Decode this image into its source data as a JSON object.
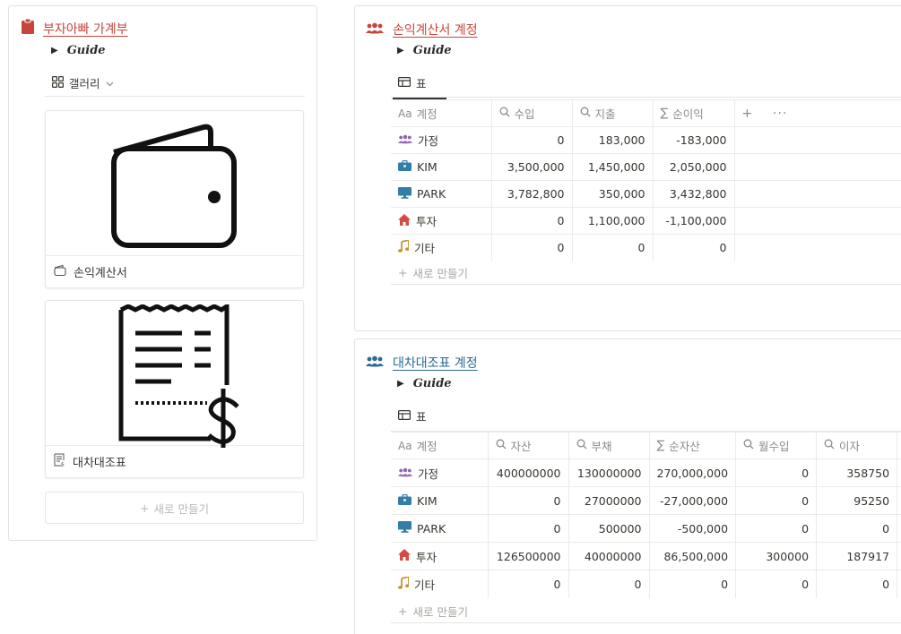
{
  "left": {
    "title": "부자아빠 가계부",
    "guide": "Guide",
    "view": "갤러리",
    "cards": [
      "손익계산서",
      "대차대조표"
    ],
    "new_label": "새로 만들기"
  },
  "pl": {
    "title": "손익계산서 계정",
    "guide": "Guide",
    "tab": "표",
    "columns": [
      "계정",
      "수입",
      "지출",
      "순이익"
    ],
    "rows": [
      {
        "name": "가정",
        "c1": "0",
        "c2": "183,000",
        "c3": "-183,000"
      },
      {
        "name": "KIM",
        "c1": "3,500,000",
        "c2": "1,450,000",
        "c3": "2,050,000"
      },
      {
        "name": "PARK",
        "c1": "3,782,800",
        "c2": "350,000",
        "c3": "3,432,800"
      },
      {
        "name": "투자",
        "c1": "0",
        "c2": "1,100,000",
        "c3": "-1,100,000"
      },
      {
        "name": "기타",
        "c1": "0",
        "c2": "0",
        "c3": "0"
      }
    ],
    "new_label": "새로 만들기",
    "add_col": "+",
    "more": "···"
  },
  "bs": {
    "title": "대차대조표 계정",
    "guide": "Guide",
    "tab": "표",
    "columns": [
      "계정",
      "자산",
      "부채",
      "순자산",
      "월수입",
      "이자"
    ],
    "rows": [
      {
        "name": "가정",
        "c1": "400000000",
        "c2": "130000000",
        "c3": "270,000,000",
        "c4": "0",
        "c5": "358750"
      },
      {
        "name": "KIM",
        "c1": "0",
        "c2": "27000000",
        "c3": "-27,000,000",
        "c4": "0",
        "c5": "95250"
      },
      {
        "name": "PARK",
        "c1": "0",
        "c2": "500000",
        "c3": "-500,000",
        "c4": "0",
        "c5": "0"
      },
      {
        "name": "투자",
        "c1": "126500000",
        "c2": "40000000",
        "c3": "86,500,000",
        "c4": "300000",
        "c5": "187917"
      },
      {
        "name": "기타",
        "c1": "0",
        "c2": "0",
        "c3": "0",
        "c4": "0",
        "c5": "0"
      }
    ],
    "new_label": "새로 만들기"
  },
  "icons": {
    "left_title": "clipboard-icon",
    "tables_title": "people-icon",
    "rows": [
      "people-icon",
      "briefcase-icon",
      "monitor-icon",
      "house-icon",
      "music-note-icon"
    ]
  },
  "colors": {
    "red_accent": "#c8453c",
    "blue_accent": "#2c6a8f",
    "purple_icon": "#9065b0",
    "teal_icon": "#337ea9",
    "house_icon": "#d44c47",
    "note_icon": "#cb912f"
  }
}
